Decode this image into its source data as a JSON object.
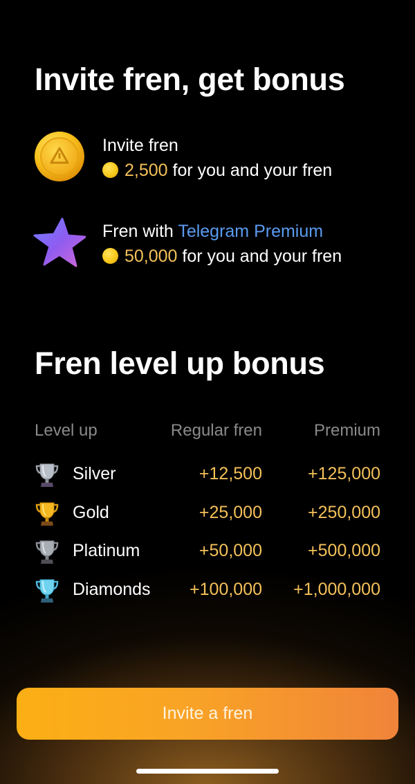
{
  "invite_section": {
    "title": "Invite fren, get bonus",
    "rows": [
      {
        "icon": "coin-icon",
        "title": "Invite fren",
        "amount": "2,500",
        "suffix": " for you and your fren"
      },
      {
        "icon": "star-icon",
        "title_prefix": "Fren with ",
        "title_highlight": "Telegram Premium",
        "amount": "50,000",
        "suffix": " for you and your fren"
      }
    ]
  },
  "levelup_section": {
    "title": "Fren level up bonus",
    "headers": {
      "level": "Level up",
      "regular": "Regular fren",
      "premium": "Premium"
    },
    "rows": [
      {
        "level": "Silver",
        "regular": "+12,500",
        "premium": "+125,000",
        "icon": "silver-trophy-icon"
      },
      {
        "level": "Gold",
        "regular": "+25,000",
        "premium": "+250,000",
        "icon": "gold-trophy-icon"
      },
      {
        "level": "Platinum",
        "regular": "+50,000",
        "premium": "+500,000",
        "icon": "platinum-trophy-icon"
      },
      {
        "level": "Diamonds",
        "regular": "+100,000",
        "premium": "+1,000,000",
        "icon": "diamond-trophy-icon"
      }
    ]
  },
  "cta": {
    "label": "Invite a fren"
  },
  "colors": {
    "accent_gold": "#f4c15a",
    "premium_blue": "#5b9bf0",
    "button_start": "#fbaf14",
    "button_end": "#f0843a"
  }
}
